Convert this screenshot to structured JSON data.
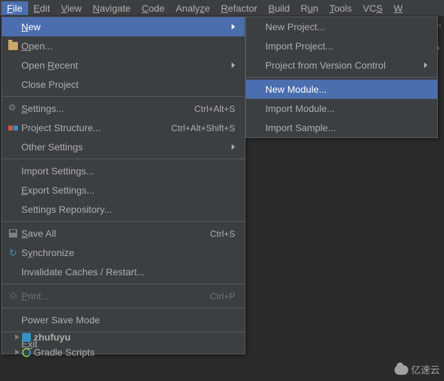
{
  "menubar": {
    "file": "File",
    "edit": "Edit",
    "view": "View",
    "navigate": "Navigate",
    "code": "Code",
    "analyze": "Analyze",
    "refactor": "Refactor",
    "build": "Build",
    "run": "Run",
    "tools": "Tools",
    "vcs": "VCS",
    "window": "W"
  },
  "fileMenu": {
    "new": "New",
    "open": "Open...",
    "openRecent": "Open Recent",
    "closeProject": "Close Project",
    "settings": {
      "label": "Settings...",
      "shortcut": "Ctrl+Alt+S"
    },
    "projectStructure": {
      "label": "Project Structure...",
      "shortcut": "Ctrl+Alt+Shift+S"
    },
    "otherSettings": "Other Settings",
    "importSettings": "Import Settings...",
    "exportSettings": "Export Settings...",
    "settingsRepo": "Settings Repository...",
    "saveAll": {
      "label": "Save All",
      "shortcut": "Ctrl+S"
    },
    "synchronize": "Synchronize",
    "invalidate": "Invalidate Caches / Restart...",
    "print": {
      "label": "Print...",
      "shortcut": "Ctrl+P"
    },
    "powerSave": "Power Save Mode",
    "exit": "Exit"
  },
  "newSubmenu": {
    "newProject": "New Project...",
    "importProject": "Import Project...",
    "fromVcs": "Project from Version Control",
    "newModule": "New Module...",
    "importModule": "Import Module...",
    "importSample": "Import Sample..."
  },
  "tree": {
    "zhufuyu": "zhufuyu",
    "gradle": "Gradle Scripts"
  },
  "watermark": "亿速云"
}
